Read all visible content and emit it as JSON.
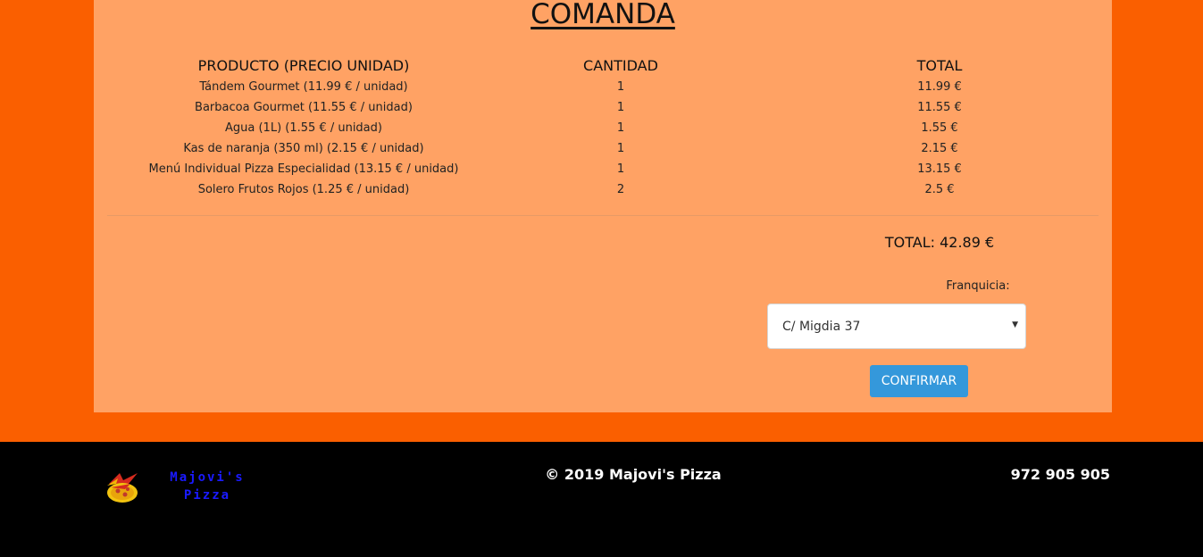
{
  "order": {
    "title": "COMANDA",
    "headers": {
      "product": "PRODUCTO (PRECIO UNIDAD)",
      "quantity": "CANTIDAD",
      "total": "TOTAL"
    },
    "rows": [
      {
        "product": "Tándem Gourmet (11.99 € / unidad)",
        "quantity": "1",
        "total": "11.99 €"
      },
      {
        "product": "Barbacoa Gourmet (11.55 € / unidad)",
        "quantity": "1",
        "total": "11.55 €"
      },
      {
        "product": "Agua (1L) (1.55 € / unidad)",
        "quantity": "1",
        "total": "1.55 €"
      },
      {
        "product": "Kas de naranja (350 ml) (2.15 € / unidad)",
        "quantity": "1",
        "total": "2.15 €"
      },
      {
        "product": "Menú Individual Pizza Especialidad (13.15 € / unidad)",
        "quantity": "1",
        "total": "13.15 €"
      },
      {
        "product": "Solero Frutos Rojos (1.25 € / unidad)",
        "quantity": "2",
        "total": "2.5 €"
      }
    ],
    "grand_total": "TOTAL: 42.89 €",
    "franchise_label": "Franquicia:",
    "franchise_selected": "C/ Migdia 37",
    "confirm_label": "CONFIRMAR"
  },
  "footer": {
    "logo_line1": "Majovi's",
    "logo_line2": "Pizza",
    "copyright": "© 2019 Majovi's Pizza",
    "phone": "972 905 905"
  },
  "colors": {
    "background": "#fa5f00",
    "panel": "#ffa264",
    "button": "#3498db",
    "footer": "#000000",
    "logo_text": "#1a1aff"
  }
}
